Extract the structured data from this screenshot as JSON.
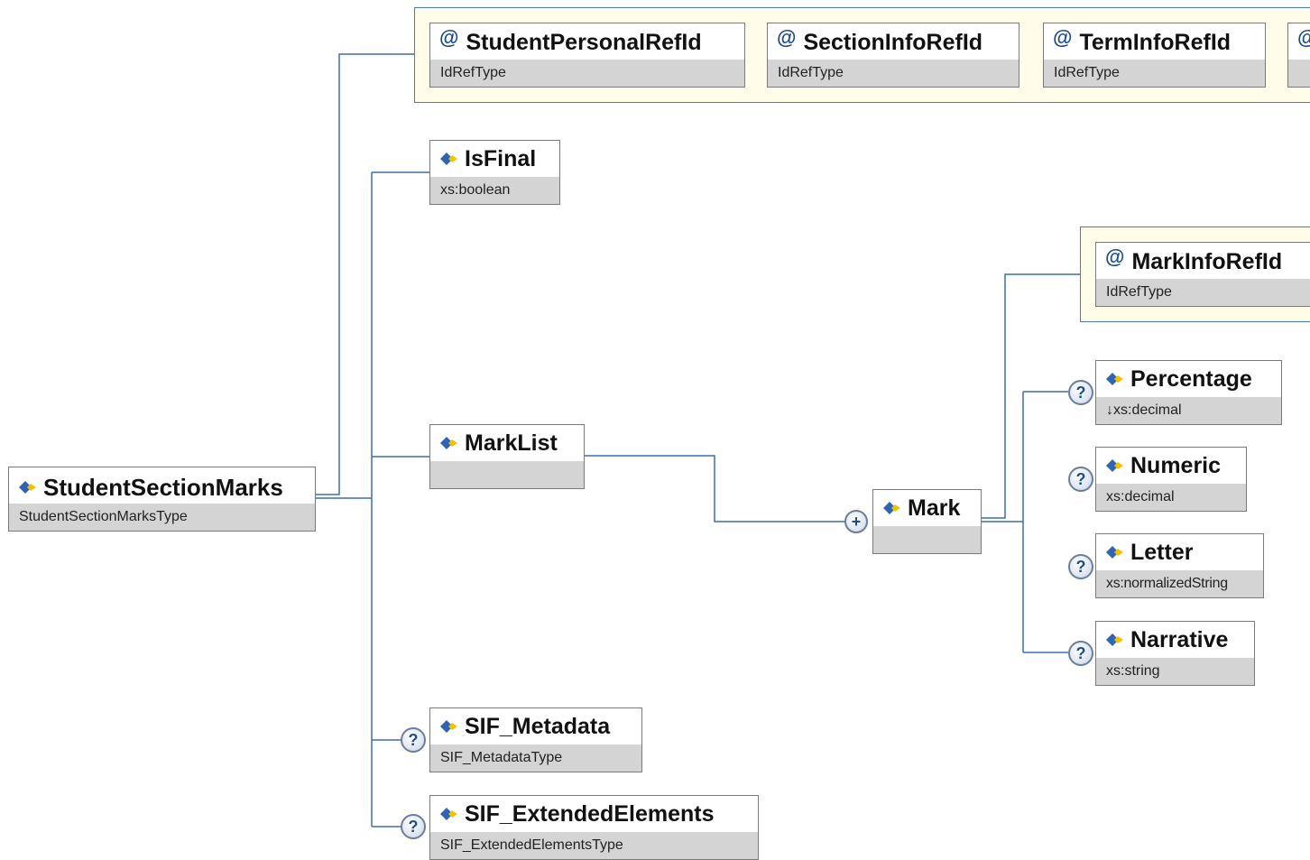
{
  "root": {
    "name": "StudentSectionMarks",
    "type": "StudentSectionMarksType"
  },
  "attributes": [
    {
      "name": "StudentPersonalRefId",
      "type": "IdRefType"
    },
    {
      "name": "SectionInfoRefId",
      "type": "IdRefType"
    },
    {
      "name": "TermInfoRefId",
      "type": "IdRefType"
    }
  ],
  "attr_symbol": "@",
  "elements": {
    "is_final": {
      "name": "IsFinal",
      "type": "xs:boolean"
    },
    "mark_list": {
      "name": "MarkList",
      "type": ""
    },
    "sif_metadata": {
      "name": "SIF_Metadata",
      "type": "SIF_MetadataType"
    },
    "sif_extended": {
      "name": "SIF_ExtendedElements",
      "type": "SIF_ExtendedElementsType"
    }
  },
  "mark": {
    "name": "Mark",
    "type": "",
    "attribute": {
      "name": "MarkInfoRefId",
      "type": "IdRefType"
    },
    "children": [
      {
        "name": "Percentage",
        "type": "↓xs:decimal"
      },
      {
        "name": "Numeric",
        "type": "xs:decimal"
      },
      {
        "name": "Letter",
        "type": "xs:normalizedString"
      },
      {
        "name": "Narrative",
        "type": "xs:string"
      }
    ]
  },
  "optional_symbol": "?",
  "expand_symbol": "+",
  "colors": {
    "connector": "#3e6ea8",
    "attr_group_bg": "#fffce9",
    "type_bar": "#d4d4d4",
    "icon_blue": "#2f64b5",
    "icon_yellow": "#f2c200"
  }
}
